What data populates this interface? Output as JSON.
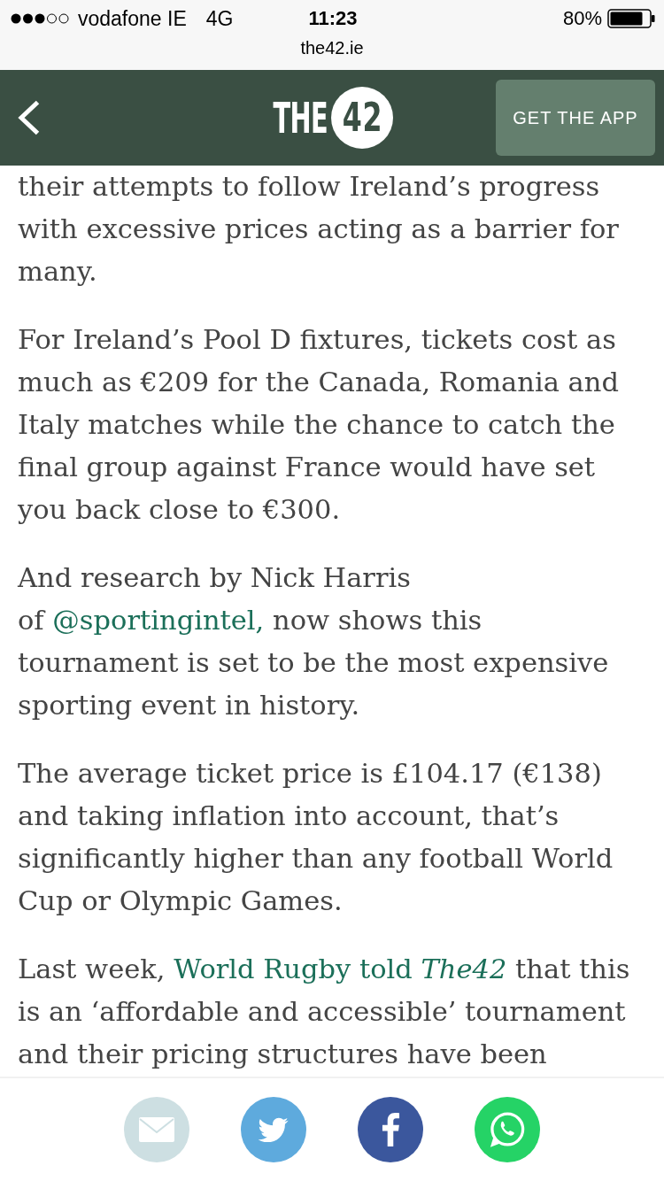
{
  "status_bar": {
    "carrier": "vodafone IE",
    "network": "4G",
    "time": "11:23",
    "battery": "80%"
  },
  "address_bar": {
    "url": "the42.ie"
  },
  "header": {
    "logo": {
      "word": "THE",
      "number": "42"
    },
    "app_button": "GET THE APP"
  },
  "article": {
    "paragraphs": [
      {
        "parts": [
          {
            "kind": "text",
            "text": "their attempts to follow Ireland’s progress with excessive prices acting as a barrier for many."
          }
        ]
      },
      {
        "parts": [
          {
            "kind": "text",
            "text": "For Ireland’s Pool D fixtures, tickets cost as much as €209 for the Canada, Romania and Italy matches while the chance to catch the final group against France would have set you back close to €300."
          }
        ]
      },
      {
        "parts": [
          {
            "kind": "text",
            "text": "And research by Nick Harris of "
          },
          {
            "kind": "link",
            "text": "@sportingintel,"
          },
          {
            "kind": "text",
            "text": " now shows this tournament is set to be the most expensive sporting event in history."
          }
        ]
      },
      {
        "parts": [
          {
            "kind": "text",
            "text": "The average ticket price is £104.17 (€138) and taking inflation into account, that’s significantly higher than any football World Cup or Olympic Games."
          }
        ]
      },
      {
        "parts": [
          {
            "kind": "text",
            "text": "Last week, "
          },
          {
            "kind": "link",
            "text": "World Rugby told *The42*"
          },
          {
            "kind": "text",
            "text": " that this is an ‘affordable and accessible’ tournament and their pricing structures have been"
          }
        ]
      }
    ]
  },
  "share_bar": {
    "buttons": [
      {
        "kind": "email"
      },
      {
        "kind": "twitter"
      },
      {
        "kind": "facebook"
      },
      {
        "kind": "whatsapp"
      }
    ]
  }
}
